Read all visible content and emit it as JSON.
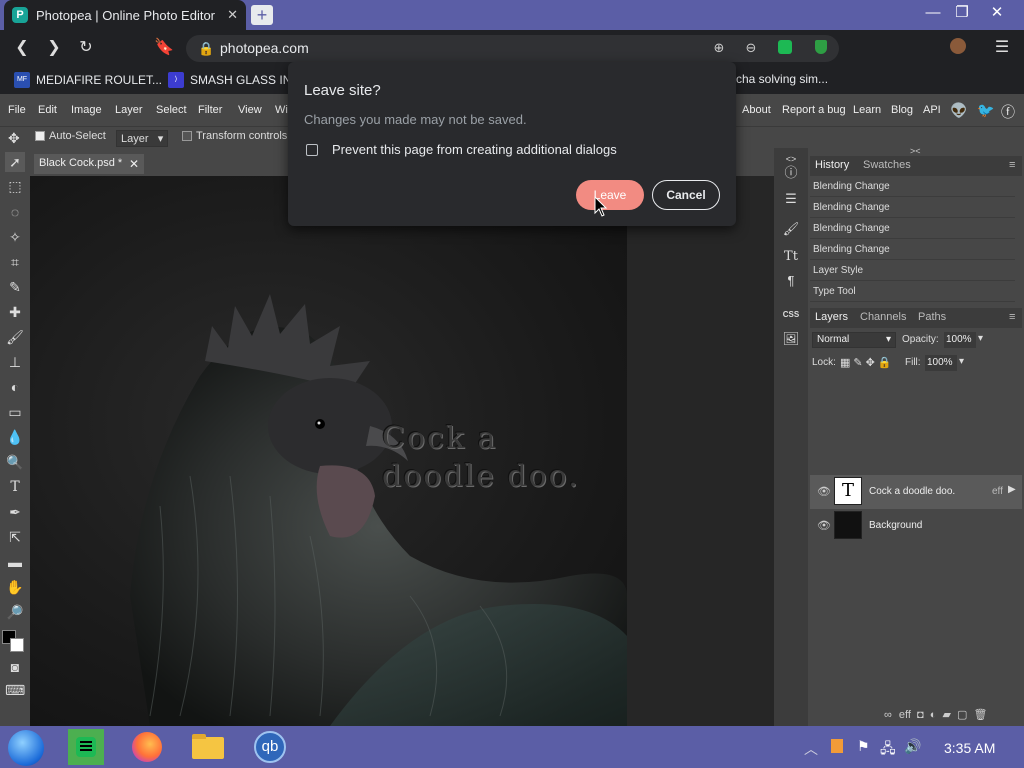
{
  "browser": {
    "tab_title": "Photopea | Online Photo Editor",
    "tab_close": "✕",
    "new_tab": "+",
    "url": "photopea.com",
    "window_controls": {
      "minimize": "—",
      "restore": "❐",
      "close": "✕"
    }
  },
  "bookmarks": [
    {
      "icon_text": "MF",
      "label": "MEDIAFIRE ROULET..."
    },
    {
      "icon_text": "",
      "label": "SMASH GLASS IN"
    },
    {
      "icon_text": "",
      "label": "cha solving sim..."
    }
  ],
  "photopea": {
    "menu": [
      "File",
      "Edit",
      "Image",
      "Layer",
      "Select",
      "Filter",
      "View",
      "Wi"
    ],
    "menu_right": [
      "About",
      "Report a bug",
      "Learn",
      "Blog",
      "API"
    ],
    "options": {
      "auto_select": "Auto-Select",
      "layer_select": "Layer",
      "transform": "Transform controls"
    },
    "doc_tab": "Black Cock.psd *",
    "doc_tab_close": "✕",
    "artwork_text_line1": "Cock a",
    "artwork_text_line2": "doodle doo.",
    "history_tabs": [
      "History",
      "Swatches"
    ],
    "history_items": [
      "Blending Change",
      "Blending Change",
      "Blending Change",
      "Blending Change",
      "Layer Style",
      "Type Tool"
    ],
    "layers_tabs": [
      "Layers",
      "Channels",
      "Paths"
    ],
    "blend_mode": "Normal",
    "opacity_label": "Opacity:",
    "opacity_value": "100%",
    "lock_label": "Lock:",
    "fill_label": "Fill:",
    "fill_value": "100%",
    "layers": [
      {
        "name": "Cock a doodle doo.",
        "thumb": "T",
        "badge": "eff"
      },
      {
        "name": "Background",
        "thumb": "",
        "badge": ""
      }
    ],
    "panel_footer": "eff"
  },
  "dialog": {
    "title": "Leave site?",
    "message": "Changes you made may not be saved.",
    "checkbox_label": "Prevent this page from creating additional dialogs",
    "leave_label": "Leave",
    "cancel_label": "Cancel"
  },
  "taskbar": {
    "time": "3:35 AM",
    "qb_label": "qb"
  },
  "colors": {
    "accent": "#5b5ea6",
    "leave_button": "#f28b82",
    "dialog_bg": "#292a2d",
    "photopea_bg": "#474747"
  }
}
